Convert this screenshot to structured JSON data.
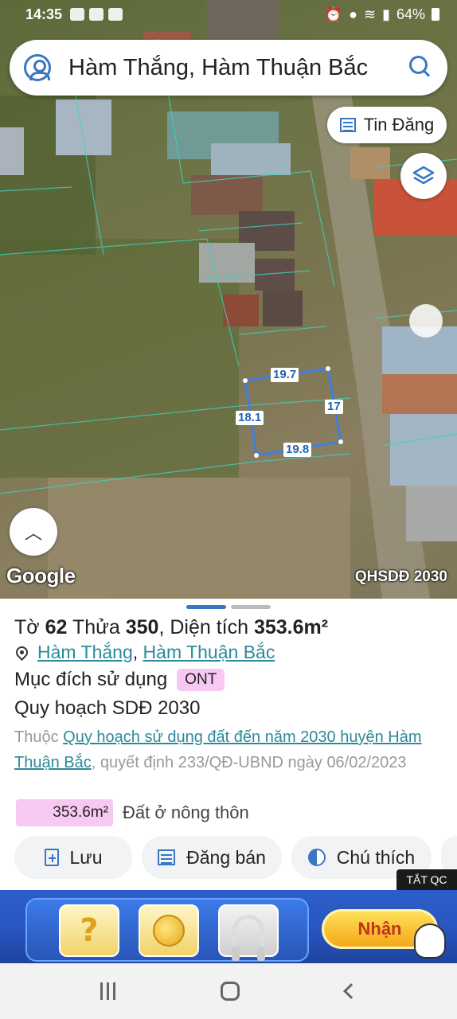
{
  "status_bar": {
    "time": "14:35",
    "battery": "64%"
  },
  "search": {
    "query": "Hàm Thắng, Hàm Thuận Bắc"
  },
  "map": {
    "tin_dang_label": "Tin Đăng",
    "google_label": "Google",
    "overlay_label": "QHSDĐ 2030",
    "dimensions": {
      "top": "19.7",
      "right": "17",
      "left": "18.1",
      "bottom": "19.8"
    }
  },
  "parcel": {
    "to_label": "Tờ",
    "to_value": "62",
    "thua_label": "Thửa",
    "thua_value": "350",
    "area_label": "Diện tích",
    "area_value": "353.6m²",
    "commune": "Hàm Thắng",
    "district": "Hàm Thuận Bắc",
    "purpose_label": "Mục đích sử dụng",
    "purpose_code": "ONT",
    "plan_title": "Quy hoạch SDĐ 2030",
    "note_prefix": "Thuộc",
    "note_link": "Quy hoạch sử dụng đất đến năm 2030 huyện Hàm Thuận Bắc",
    "note_suffix": ", quyết định 233/QĐ-UBND ngày 06/02/2023",
    "legend_area": "353.6m²",
    "legend_label": "Đất ở nông thôn",
    "legend_color": "#f6c8f2"
  },
  "actions": {
    "save": "Lưu",
    "post_sale": "Đăng bán",
    "legend": "Chú thích"
  },
  "ad": {
    "tag": "TẮT QC",
    "cta": "Nhận",
    "tile_mark": "?"
  },
  "colors": {
    "accent": "#3a76c4",
    "link": "#2b8a9a",
    "parcel_line": "#3f7fe0"
  }
}
